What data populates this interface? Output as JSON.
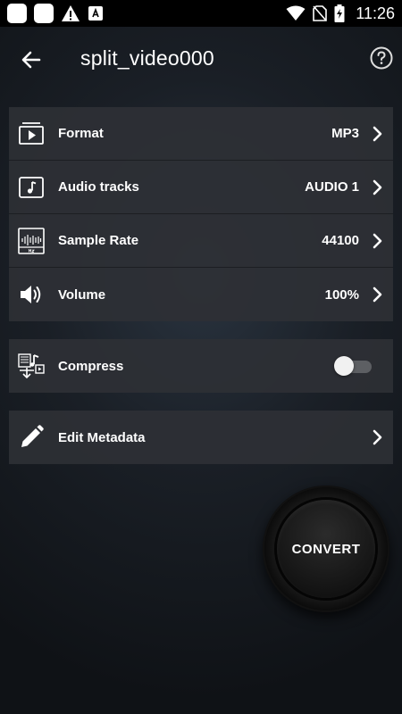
{
  "status_bar": {
    "time": "11:26"
  },
  "header": {
    "title": "split_video000"
  },
  "settings": [
    {
      "label": "Format",
      "value": "MP3"
    },
    {
      "label": "Audio tracks",
      "value": "AUDIO 1"
    },
    {
      "label": "Sample Rate",
      "value": "44100"
    },
    {
      "label": "Volume",
      "value": "100%"
    }
  ],
  "compress": {
    "label": "Compress",
    "enabled": false
  },
  "metadata": {
    "label": "Edit Metadata"
  },
  "convert": {
    "label": "CONVERT"
  }
}
